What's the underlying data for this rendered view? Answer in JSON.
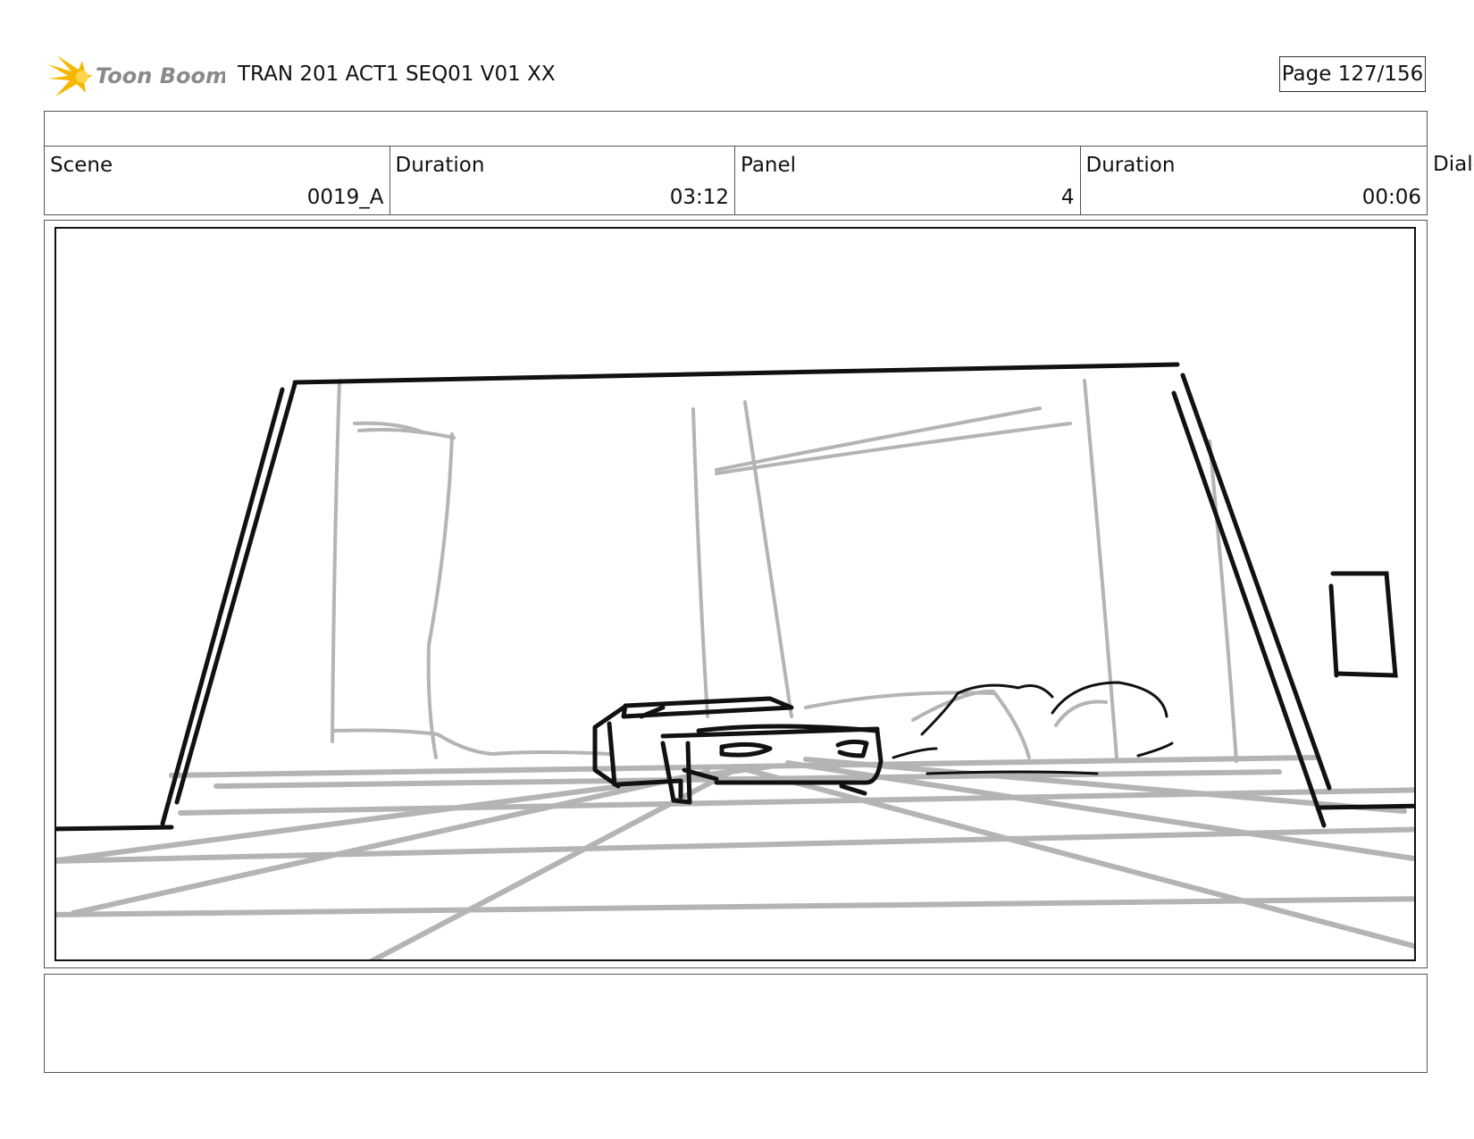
{
  "header": {
    "logo_text": "Toon Boom",
    "doc_title": "TRAN 201 ACT1 SEQ01 V01 XX",
    "page": "Page 127/156"
  },
  "info": {
    "scene_label": "Scene",
    "scene_value": "0019_A",
    "scene_duration_label": "Duration",
    "scene_duration_value": "03:12",
    "panel_label": "Panel",
    "panel_value": "4",
    "panel_duration_label": "Duration",
    "panel_duration_value": "00:06",
    "dialog_label_partial": "Dialo"
  },
  "colors": {
    "logo_star": "#f5b800",
    "logo_text": "#8a8a8a",
    "sketch_black": "#111111",
    "sketch_gray": "#b4b4b4"
  }
}
